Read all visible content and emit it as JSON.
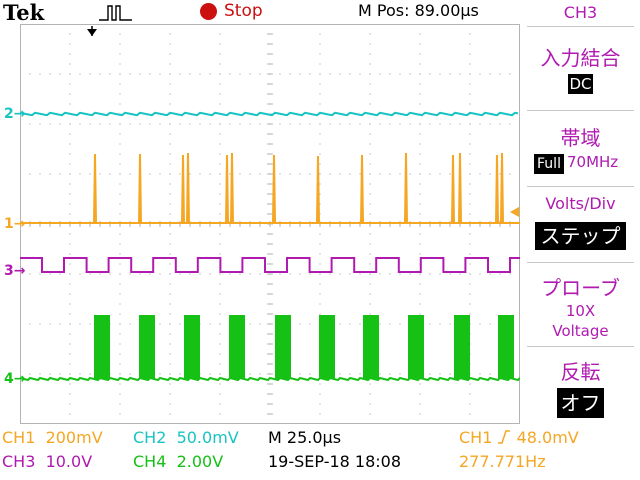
{
  "header": {
    "brand": "Tek",
    "run_state": "Stop",
    "m_pos": "M Pos: 89.00µs"
  },
  "side_menu": {
    "channel": "CH3",
    "coupling": {
      "title": "入力結合",
      "value": "DC"
    },
    "bandwidth": {
      "title": "帯域",
      "value_box": "Full",
      "value_text": "70MHz"
    },
    "volts_div": {
      "title": "Volts/Div",
      "value": "ステップ"
    },
    "probe": {
      "title": "プローブ",
      "value_line1": "10X",
      "value_line2": "Voltage"
    },
    "invert": {
      "title": "反転",
      "value": "オフ"
    }
  },
  "channel_markers": {
    "ch1": "1",
    "ch2": "2",
    "ch3": "3",
    "ch4": "4"
  },
  "status": {
    "ch1_label": "CH1",
    "ch1_scale": "200mV",
    "ch2_label": "CH2",
    "ch2_scale": "50.0mV",
    "ch3_label": "CH3",
    "ch3_scale": "10.0V",
    "ch4_label": "CH4",
    "ch4_scale": "2.00V",
    "timebase": "M 25.0µs",
    "datetime": "19-SEP-18 18:08",
    "trigger_source": "CH1",
    "trigger_level": "48.0mV",
    "frequency": "277.771Hz"
  },
  "colors": {
    "ch1": "#f5a623",
    "ch2": "#19c3c3",
    "ch3": "#b01ab0",
    "ch4": "#16c116",
    "stop": "#cc1010",
    "grid": "#b4b4b4"
  }
}
